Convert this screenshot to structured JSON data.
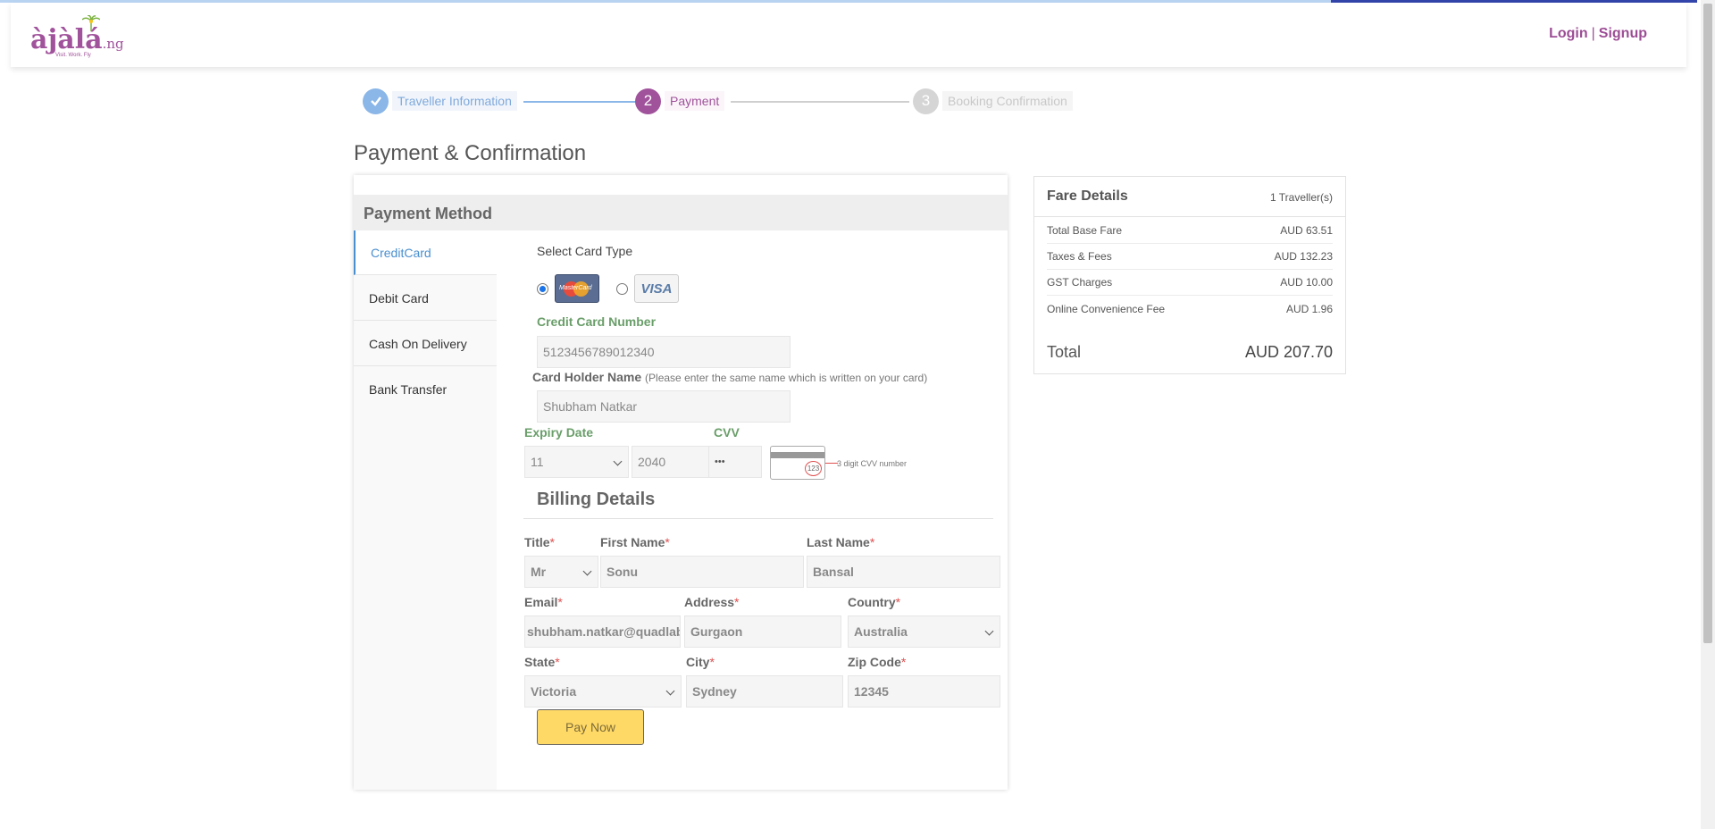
{
  "brand": {
    "logo_text": "àjàlá",
    "logo_suffix": ".ng",
    "tagline": "Visit. Work. Fly",
    "brand_color": "#a0529b"
  },
  "header": {
    "login_label": "Login",
    "separator": "|",
    "signup_label": "Signup"
  },
  "stepper": {
    "steps": [
      {
        "number": "✓",
        "label": "Traveller Information",
        "state": "done"
      },
      {
        "number": "2",
        "label": "Payment",
        "state": "active"
      },
      {
        "number": "3",
        "label": "Booking Confirmation",
        "state": "pending"
      }
    ]
  },
  "page_title": "Payment & Confirmation",
  "payment": {
    "header": "Payment Method",
    "methods": [
      "CreditCard",
      "Debit Card",
      "Cash On Delivery",
      "Bank Transfer"
    ],
    "active_method": "CreditCard",
    "select_card_type_label": "Select Card Type",
    "card_types": [
      {
        "name": "MasterCard",
        "selected": true
      },
      {
        "name": "VISA",
        "selected": false
      }
    ],
    "card_number_label": "Credit Card Number",
    "card_number_value": "5123456789012340",
    "holder_label": "Card Holder Name",
    "holder_hint": "(Please enter the same name which is written on your card)",
    "holder_value": "Shubham Natkar",
    "expiry_label": "Expiry Date",
    "expiry_month": "11",
    "expiry_year": "2040",
    "cvv_label": "CVV",
    "cvv_value": "•••",
    "cvv_sample": "123",
    "cvv_hint": "3 digit CVV number"
  },
  "billing": {
    "title": "Billing Details",
    "required_mark": "*",
    "title_label": "Title",
    "title_value": "Mr",
    "first_name_label": "First Name",
    "first_name_value": "Sonu",
    "last_name_label": "Last Name",
    "last_name_value": "Bansal",
    "email_label": "Email",
    "email_value": "shubham.natkar@quadlab",
    "address_label": "Address",
    "address_value": "Gurgaon",
    "country_label": "Country",
    "country_value": "Australia",
    "state_label": "State",
    "state_value": "Victoria",
    "city_label": "City",
    "city_value": "Sydney",
    "zip_label": "Zip Code",
    "zip_value": "12345",
    "pay_button": "Pay Now"
  },
  "fare": {
    "title": "Fare Details",
    "travellers": "1 Traveller(s)",
    "rows": [
      {
        "label": "Total Base Fare",
        "value": "AUD 63.51"
      },
      {
        "label": "Taxes & Fees",
        "value": "AUD 132.23"
      },
      {
        "label": "GST Charges",
        "value": "AUD 10.00"
      },
      {
        "label": "Online Convenience Fee",
        "value": "AUD 1.96"
      }
    ],
    "total_label": "Total",
    "total_value": "AUD 207.70"
  },
  "colors": {
    "step_done": "#8ab6e8",
    "step_active": "#a0529b",
    "step_pending": "#d5d5d5",
    "active_tab": "#4a8fcf",
    "label_green": "#6a9e6a",
    "pay_button_bg": "#ffd966"
  }
}
